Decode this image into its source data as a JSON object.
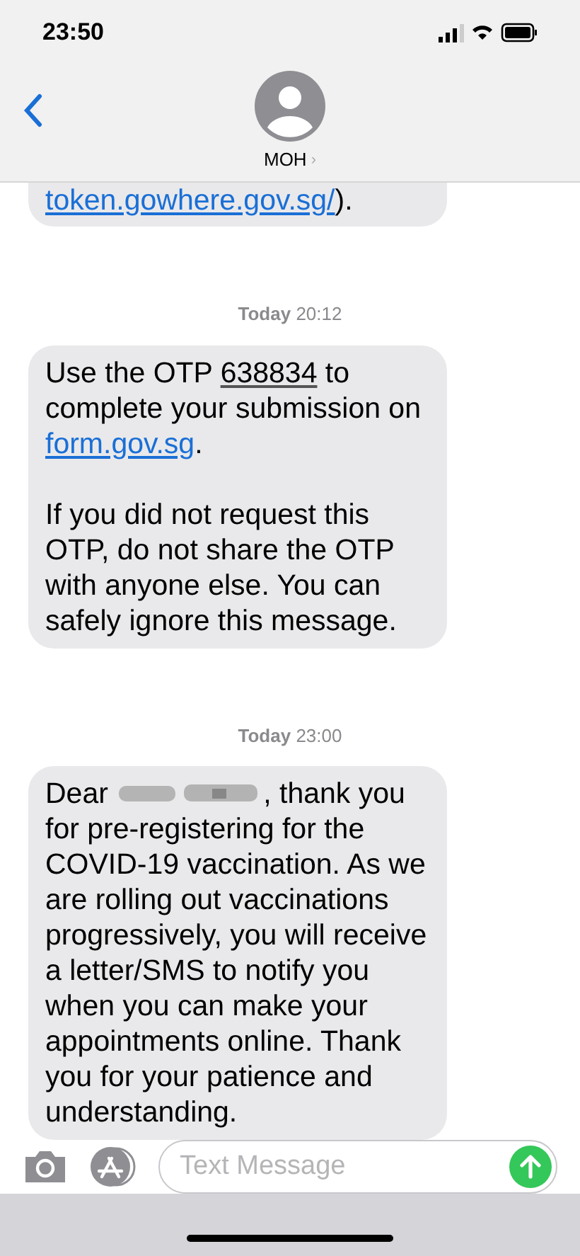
{
  "status_bar": {
    "time": "23:50"
  },
  "header": {
    "contact": "MOH",
    "chevron": "›"
  },
  "messages": [
    {
      "cut_top": true,
      "paragraphs": [
        [
          {
            "kind": "link",
            "text": "token.gowhere.gov.sg/"
          },
          {
            "kind": "text",
            "text": ")."
          }
        ]
      ]
    },
    {
      "cut_top": false,
      "timestamp": {
        "day": "Today",
        "time": "20:12"
      },
      "paragraphs": [
        [
          {
            "kind": "text",
            "text": "Use the OTP "
          },
          {
            "kind": "detected",
            "text": "638834"
          },
          {
            "kind": "text",
            "text": " to complete your submission on "
          },
          {
            "kind": "link",
            "text": "form.gov.sg"
          },
          {
            "kind": "text",
            "text": "."
          }
        ],
        [
          {
            "kind": "text",
            "text": "If you did not request this OTP, do not share the OTP with anyone else. You can safely ignore this message."
          }
        ]
      ]
    },
    {
      "cut_top": false,
      "timestamp": {
        "day": "Today",
        "time": "23:00"
      },
      "paragraphs": [
        [
          {
            "kind": "text",
            "text": "Dear "
          },
          {
            "kind": "redacted"
          },
          {
            "kind": "text",
            "text": ", thank you for pre-registering for the COVID-19 vaccination. As we are rolling out vaccinations progressively, you will receive a letter/SMS to notify you when you can make your appointments online. Thank you for your patience and understanding."
          }
        ]
      ]
    }
  ],
  "composer": {
    "placeholder": "Text Message"
  }
}
